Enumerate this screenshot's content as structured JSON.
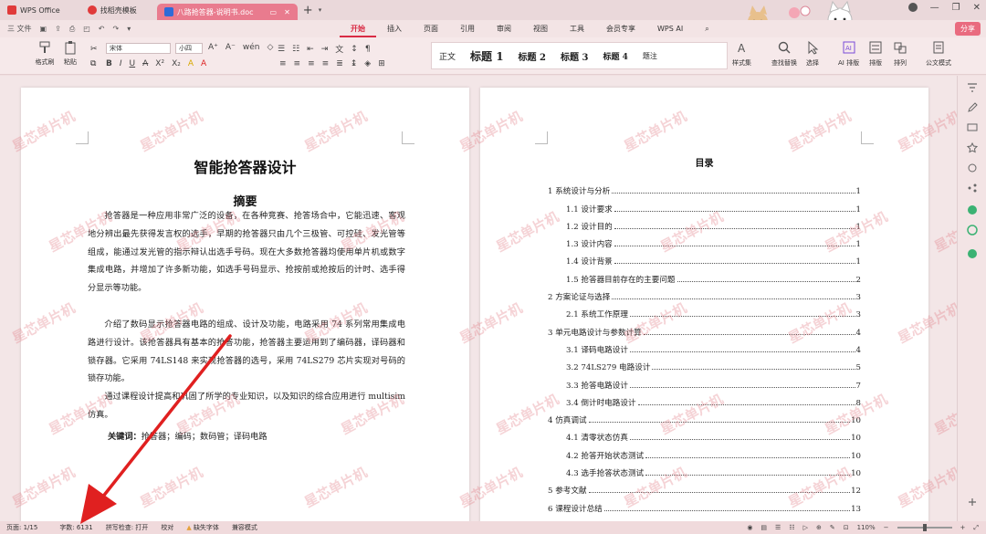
{
  "tabs": [
    {
      "label": "WPS Office",
      "color": "#e03a3a"
    },
    {
      "label": "找稻壳模板",
      "color": "#e03a3a"
    },
    {
      "label": "八路抢答器-说明书.doc",
      "color": "#2f6bd8",
      "active": true
    }
  ],
  "tab_add": "+",
  "window_controls": [
    "—",
    "❐",
    "✕"
  ],
  "menu": {
    "file_label": "三 文件",
    "tabs": [
      "开始",
      "插入",
      "页面",
      "引用",
      "审阅",
      "视图",
      "工具",
      "会员专享",
      "WPS AI"
    ],
    "active_tab": "开始",
    "share_label": "分享"
  },
  "ribbon": {
    "format_painter": "格式刷",
    "paste": "粘贴",
    "font_name": "宋体",
    "font_size": "小四",
    "styles": [
      "正文",
      "标题 1",
      "标题 2",
      "标题 3",
      "标题 4",
      "题注"
    ],
    "right_tools": [
      "样式集",
      "查找替换",
      "选择",
      "AI 排版",
      "排版",
      "排列",
      "公文模式"
    ]
  },
  "page1": {
    "title": "智能抢答器设计",
    "abstract_heading": "摘要",
    "paragraphs": [
      "抢答器是一种应用非常广泛的设备，在各种竞赛、抢答场合中，它能迅速、客观地分辨出最先获得发言权的选手，早期的抢答器只由几个三极管、可控硅、发光管等组成，能通过发光管的指示辩认出选手号码。现在大多数抢答器均使用单片机或数字集成电路，并增加了许多新功能，如选手号码显示、抢按前或抢按后的计时、选手得分显示等功能。",
      "介绍了数码显示抢答器电路的组成、设计及功能，电路采用 74 系列常用集成电路进行设计。该抢答器具有基本的抢答功能，抢答器主要运用到了编码器，译码器和锁存器。它采用 74LS148 来实现抢答器的选号，采用 74LS279 芯片实现对号码的锁存功能。",
      "通过课程设计提高和巩固了所学的专业知识，以及知识的综合应用进行 multisim 仿真。"
    ],
    "keywords_label": "关键词：",
    "keywords": "抢答器；编码；数码管；译码电路"
  },
  "page2": {
    "toc_title": "目录",
    "toc": [
      {
        "text": "1 系统设计与分析",
        "page": "1",
        "level": 1
      },
      {
        "text": "1.1 设计要求",
        "page": "1",
        "level": 2
      },
      {
        "text": "1.2 设计目的",
        "page": "1",
        "level": 2
      },
      {
        "text": "1.3 设计内容",
        "page": "1",
        "level": 2
      },
      {
        "text": "1.4 设计背景",
        "page": "1",
        "level": 2
      },
      {
        "text": "1.5 抢答器目前存在的主要问题",
        "page": "2",
        "level": 2
      },
      {
        "text": "2 方案论证与选择",
        "page": "3",
        "level": 1
      },
      {
        "text": "2.1 系统工作原理",
        "page": "3",
        "level": 2
      },
      {
        "text": "3 单元电路设计与参数计算",
        "page": "4",
        "level": 1
      },
      {
        "text": "3.1 译码电路设计",
        "page": "4",
        "level": 2
      },
      {
        "text": "3.2 74LS279 电路设计",
        "page": "5",
        "level": 2
      },
      {
        "text": "3.3 抢答电路设计",
        "page": "7",
        "level": 2
      },
      {
        "text": "3.4 倒计时电路设计",
        "page": "8",
        "level": 2
      },
      {
        "text": "4 仿真调试",
        "page": "10",
        "level": 1
      },
      {
        "text": "4.1 清零状态仿真",
        "page": "10",
        "level": 2
      },
      {
        "text": "4.2 抢答开始状态测试",
        "page": "10",
        "level": 2
      },
      {
        "text": "4.3 选手抢答状态测试",
        "page": "10",
        "level": 2
      },
      {
        "text": "5 参考文献",
        "page": "12",
        "level": 1
      },
      {
        "text": "6 课程设计总结",
        "page": "13",
        "level": 1
      }
    ]
  },
  "watermark": "星芯单片机",
  "statusbar": {
    "page": "页面: 1/15",
    "words": "字数: 6131",
    "spellcheck": "拼写检查: 打开",
    "proofread": "校对",
    "missing_font": "缺失字体",
    "compat": "兼容模式",
    "zoom": "110%"
  },
  "colors": {
    "accent": "#d92b44",
    "arrow": "#e02020",
    "watermark": "#e27882"
  }
}
